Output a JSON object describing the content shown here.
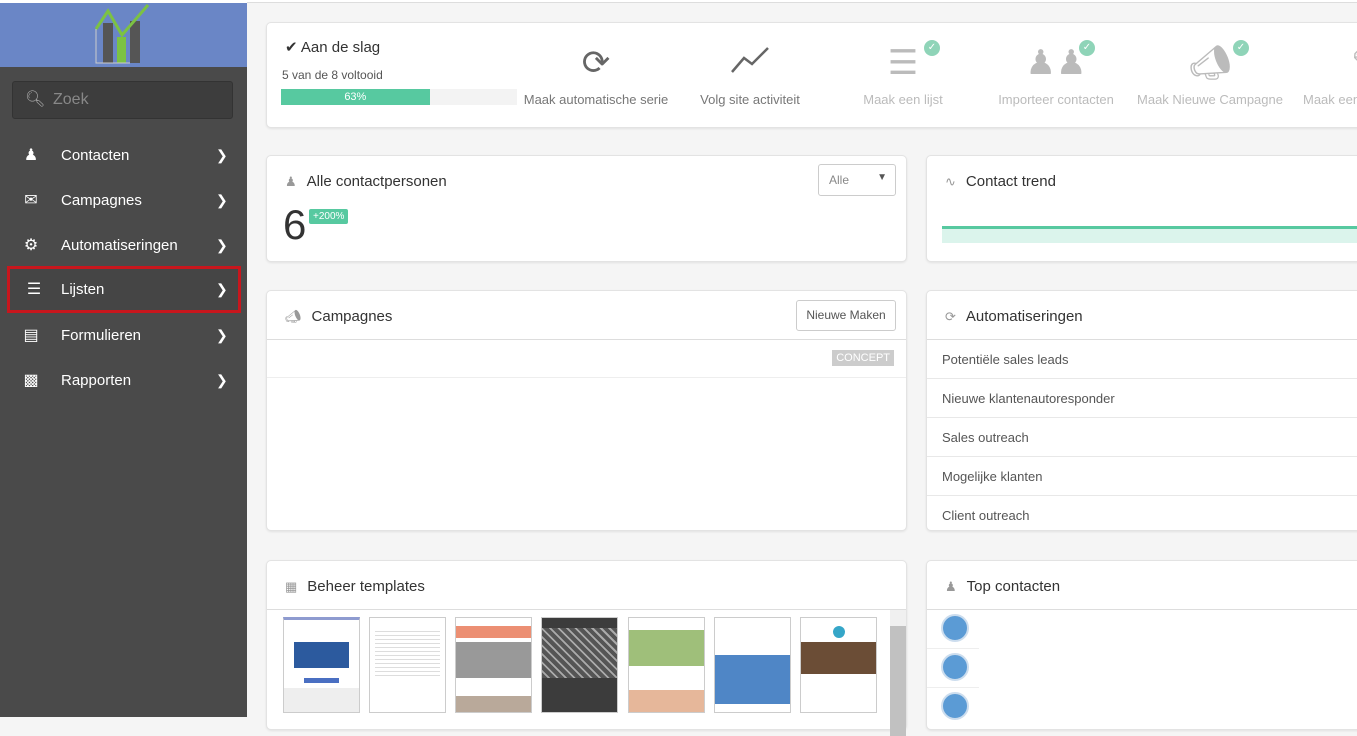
{
  "sidebar": {
    "search_placeholder": "Zoek",
    "items": [
      {
        "label": "Contacten",
        "icon": "contacts-icon"
      },
      {
        "label": "Campagnes",
        "icon": "envelope-icon"
      },
      {
        "label": "Automatiseringen",
        "icon": "automation-icon"
      },
      {
        "label": "Lijsten",
        "icon": "list-icon",
        "highlighted": true
      },
      {
        "label": "Formulieren",
        "icon": "form-icon"
      },
      {
        "label": "Rapporten",
        "icon": "bar-chart-icon"
      }
    ]
  },
  "getting_started": {
    "title": "Aan de slag",
    "subtitle": "5 van de 8 voltooid",
    "progress_label": "63%",
    "progress": 63,
    "steps": [
      {
        "label": "Maak automatische serie",
        "done": false
      },
      {
        "label": "Volg site activiteit",
        "done": false
      },
      {
        "label": "Maak een lijst",
        "done": true
      },
      {
        "label": "Importeer contacten",
        "done": true
      },
      {
        "label": "Maak Nieuwe Campagne",
        "done": true
      },
      {
        "label": "Maak een",
        "done": false
      }
    ]
  },
  "contacts": {
    "title": "Alle contactpersonen",
    "count": "6",
    "change": "+200%",
    "filter": "Alle"
  },
  "trend": {
    "title": "Contact trend"
  },
  "campaigns": {
    "title": "Campagnes",
    "new_button": "Nieuwe Maken",
    "badge": "CONCEPT"
  },
  "automations": {
    "title": "Automatiseringen",
    "items": [
      "Potentiële sales leads",
      "Nieuwe klantenautoresponder",
      "Sales outreach",
      "Mogelijke klanten",
      "Client outreach"
    ]
  },
  "templates": {
    "title": "Beheer templates"
  },
  "top_contacts": {
    "title": "Top contacten"
  },
  "colors": {
    "sidebar": "#4a4a4a",
    "logo_bg": "#6a86c6",
    "accent": "#57c9a0",
    "highlight": "#c8161d"
  }
}
